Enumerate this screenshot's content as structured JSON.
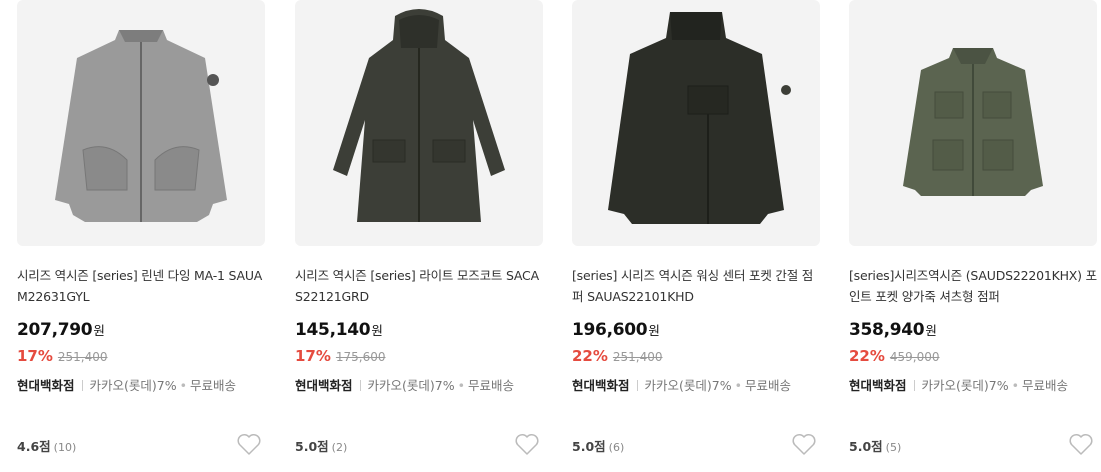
{
  "products": [
    {
      "title": "시리즈 역시즌 [series] 린넨 다잉 MA-1 SAUAM22631GYL",
      "price": "207,790",
      "currency": "원",
      "discount_rate": "17%",
      "original_price": "251,400",
      "store": "현대백화점",
      "card_benefit": "카카오(롯데)7%",
      "shipping": "무료배송",
      "rating": "4.6점",
      "review_count": "(10)",
      "image_color": "#9a9a9a"
    },
    {
      "title": "시리즈 역시즌 [series] 라이트 모즈코트 SACAS22121GRD",
      "price": "145,140",
      "currency": "원",
      "discount_rate": "17%",
      "original_price": "175,600",
      "store": "현대백화점",
      "card_benefit": "카카오(롯데)7%",
      "shipping": "무료배송",
      "rating": "5.0점",
      "review_count": "(2)",
      "image_color": "#3c3e37"
    },
    {
      "title": "[series] 시리즈 역시즌 워싱 센터 포켓 간절 점퍼 SAUAS22101KHD",
      "price": "196,600",
      "currency": "원",
      "discount_rate": "22%",
      "original_price": "251,400",
      "store": "현대백화점",
      "card_benefit": "카카오(롯데)7%",
      "shipping": "무료배송",
      "rating": "5.0점",
      "review_count": "(6)",
      "image_color": "#2c2e28"
    },
    {
      "title": "[series]시리즈역시즌 (SAUDS22201KHX) 포인트 포켓 양가죽 셔츠형 점퍼",
      "price": "358,940",
      "currency": "원",
      "discount_rate": "22%",
      "original_price": "459,000",
      "store": "현대백화점",
      "card_benefit": "카카오(롯데)7%",
      "shipping": "무료배송",
      "rating": "5.0점",
      "review_count": "(5)",
      "image_color": "#5b6450"
    }
  ],
  "accent_color": "#e54b3f"
}
